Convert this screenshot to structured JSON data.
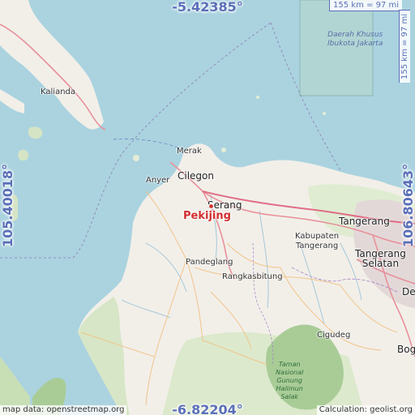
{
  "map": {
    "place_name": "Pekijing",
    "coords": {
      "top_lat": "-5.42385°",
      "bottom_lat": "-6.82204°",
      "left_lon": "105.40018°",
      "right_lon": "106.80643°"
    },
    "scale": {
      "horizontal": "155 km = 97 mi",
      "vertical": "155 km = 97 mi"
    },
    "attribution_left": "map data: openstreetmap.org",
    "attribution_right": "Calculation: geolist.org",
    "labels": {
      "kalianda": "Kalianda",
      "merak": "Merak",
      "anyer": "Anyer",
      "cilegon": "Cilegon",
      "serang": "Serang",
      "tangerang": "Tangerang",
      "kabupaten_tangerang": "Kabupaten\nTangerang",
      "tangerang_selatan": "Tangerang\nSelatan",
      "pandeglang": "Pandeglang",
      "rangkasbitung": "Rangkasbitung",
      "cigudeg": "Cigudeg",
      "bogor": "Bog",
      "depok": "De",
      "dki": "Daerah Khusus\nIbukota Jakarta",
      "park": "Taman\nNasional\nGunung\nHalimun\nSalak"
    },
    "colors": {
      "water": "#aad3df",
      "land": "#f2efe9",
      "forest": "#c8dfb6",
      "park": "#a9cc97",
      "road_major": "#e8909a",
      "road_minor": "#f2c48a",
      "coord_text": "#5a6fb8",
      "marker": "#d12f2f"
    }
  }
}
